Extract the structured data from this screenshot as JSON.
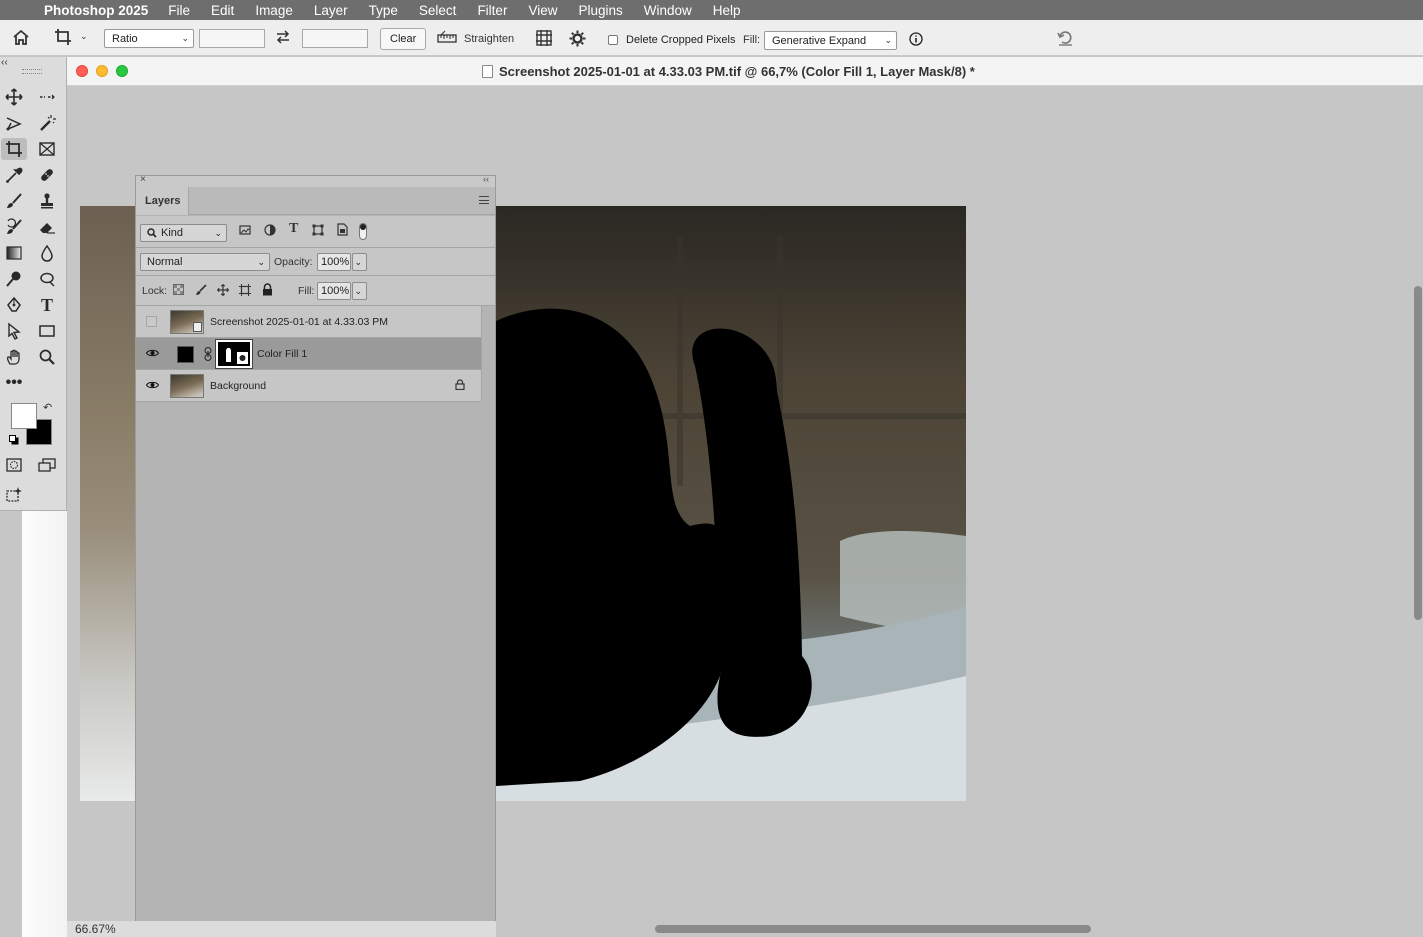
{
  "menubar": {
    "app": "Photoshop 2025",
    "items": [
      "File",
      "Edit",
      "Image",
      "Layer",
      "Type",
      "Select",
      "Filter",
      "View",
      "Plugins",
      "Window",
      "Help"
    ]
  },
  "options": {
    "ratio": "Ratio",
    "clear": "Clear",
    "straighten": "Straighten",
    "delete_cropped": "Delete Cropped Pixels",
    "fill_label": "Fill:",
    "fill_value": "Generative Expand"
  },
  "document": {
    "title": "Screenshot 2025-01-01 at 4.33.03 PM.tif @ 66,7% (Color Fill 1, Layer Mask/8) *",
    "zoom": "66.67%"
  },
  "layers_panel": {
    "tab": "Layers",
    "filter_kind": "Kind",
    "blend_mode": "Normal",
    "opacity_label": "Opacity:",
    "opacity": "100%",
    "lock_label": "Lock:",
    "fill_label": "Fill:",
    "fill": "100%",
    "layers": [
      {
        "name": "Screenshot 2025-01-01 at 4.33.03 PM",
        "visible": false,
        "selected": false
      },
      {
        "name": "Color Fill 1",
        "visible": true,
        "selected": true
      },
      {
        "name": "Background",
        "visible": true,
        "selected": false,
        "locked": true
      }
    ]
  },
  "colors": {
    "foreground": "#ffffff",
    "background": "#000000",
    "menubar": "#6e6e6e"
  }
}
